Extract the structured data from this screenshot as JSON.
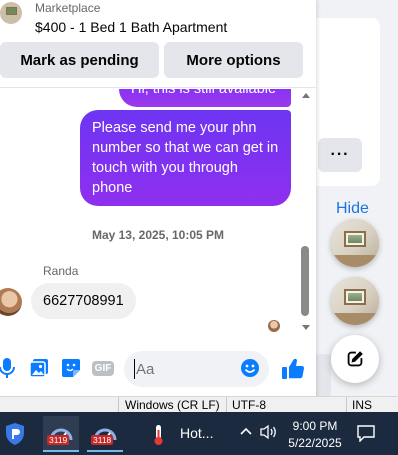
{
  "header": {
    "subtitle": "Marketplace",
    "title": "$400 - 1 Bed 1 Bath Apartment",
    "pending_label": "Mark as pending",
    "options_label": "More options"
  },
  "messages": {
    "out_1": "Hi, this is still available",
    "out_2": "Please send me your phn number so that we can get in touch with you through phone",
    "date_separator": "May 13, 2025, 10:05 PM",
    "sender_name": "Randa",
    "in_1": "6627708991"
  },
  "composer": {
    "placeholder": "Aa",
    "gif_label": "GIF"
  },
  "background": {
    "hide_label": "Hide",
    "more_label": "···"
  },
  "editor_status": {
    "line_ending": "Windows (CR LF)",
    "charset": "UTF-8",
    "mode": "INS"
  },
  "taskbar": {
    "app1_badge": "3119",
    "app2_badge": "3118",
    "weather_text": "Hot...",
    "time": "9:00 PM",
    "date": "5/22/2025"
  },
  "colors": {
    "accent": "#1b74e4",
    "bubble_out": "#7b2ff7",
    "taskbar": "#1c2a3f"
  }
}
